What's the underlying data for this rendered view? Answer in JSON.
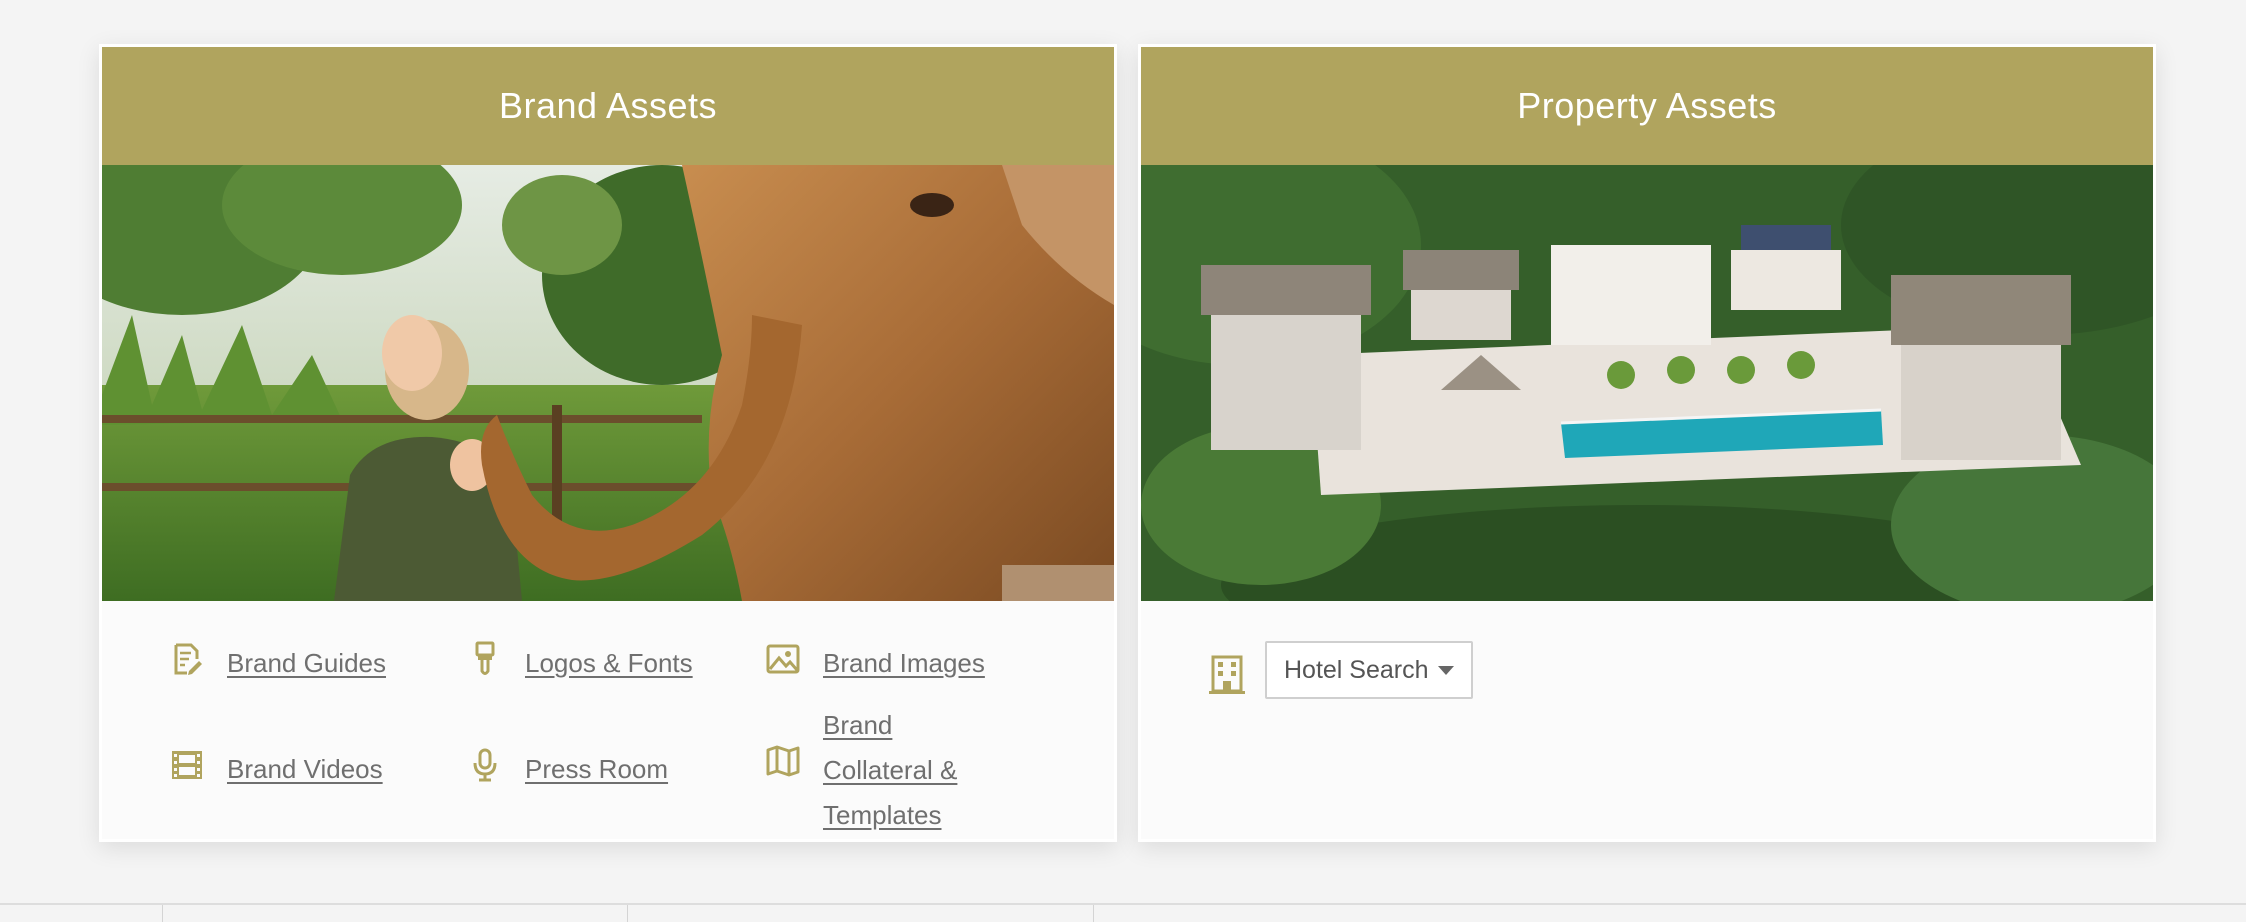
{
  "brand_card": {
    "title": "Brand Assets",
    "links": [
      {
        "label": "Brand Guides",
        "icon": "document-edit-icon"
      },
      {
        "label": "Logos & Fonts",
        "icon": "paint-brush-icon"
      },
      {
        "label": "Brand Images",
        "icon": "image-icon"
      },
      {
        "label": "Brand Videos",
        "icon": "film-strip-icon"
      },
      {
        "label": "Press Room",
        "icon": "microphone-icon"
      },
      {
        "label": "Brand Collateral & Templates",
        "icon": "map-brochure-icon"
      }
    ]
  },
  "property_card": {
    "title": "Property Assets",
    "hotel_search": {
      "selected": "Hotel Search"
    }
  },
  "colors": {
    "header_bg": "#b0a45e",
    "icon_gold": "#b0a45e",
    "link_text": "#6f6f6f"
  }
}
